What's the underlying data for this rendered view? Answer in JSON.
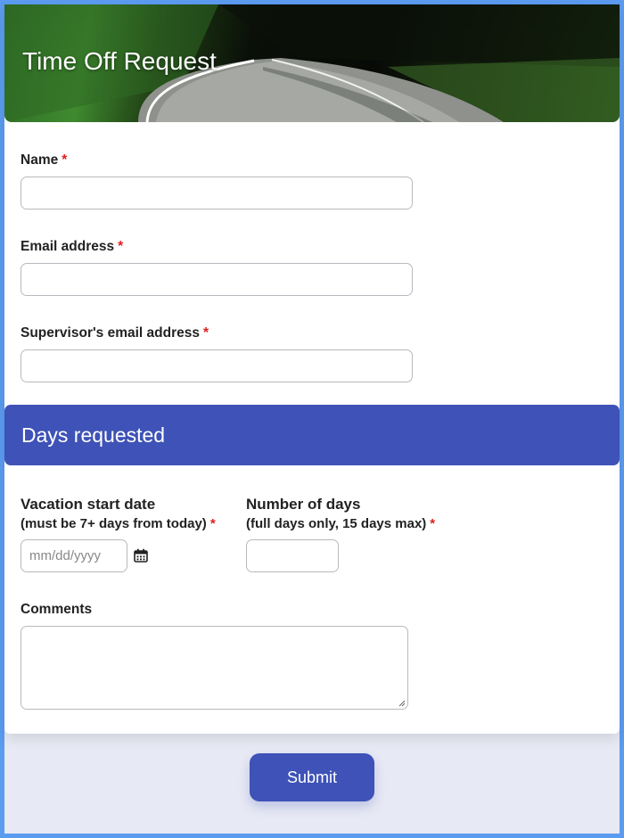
{
  "header": {
    "title": "Time Off Request"
  },
  "fields": {
    "name": {
      "label": "Name",
      "required_marker": "*",
      "value": ""
    },
    "email": {
      "label": "Email address",
      "required_marker": "*",
      "value": ""
    },
    "supervisor_email": {
      "label": "Supervisor's email address",
      "required_marker": "*",
      "value": ""
    }
  },
  "days_section": {
    "title": "Days requested",
    "start_date": {
      "label": "Vacation start date",
      "sublabel": "(must be 7+ days from today)",
      "required_marker": "*",
      "placeholder": "mm/dd/yyyy"
    },
    "num_days": {
      "label": "Number of days",
      "sublabel": "(full days only, 15 days max)",
      "required_marker": "*",
      "value": ""
    },
    "comments": {
      "label": "Comments",
      "value": ""
    }
  },
  "submit": {
    "label": "Submit"
  },
  "colors": {
    "accent": "#3e52b7",
    "frame": "#5b9bf0",
    "required": "#e02020",
    "page_background": "#e7e9f4"
  },
  "icons": {
    "calendar": "calendar-icon",
    "resize": "resize-handle-icon"
  }
}
